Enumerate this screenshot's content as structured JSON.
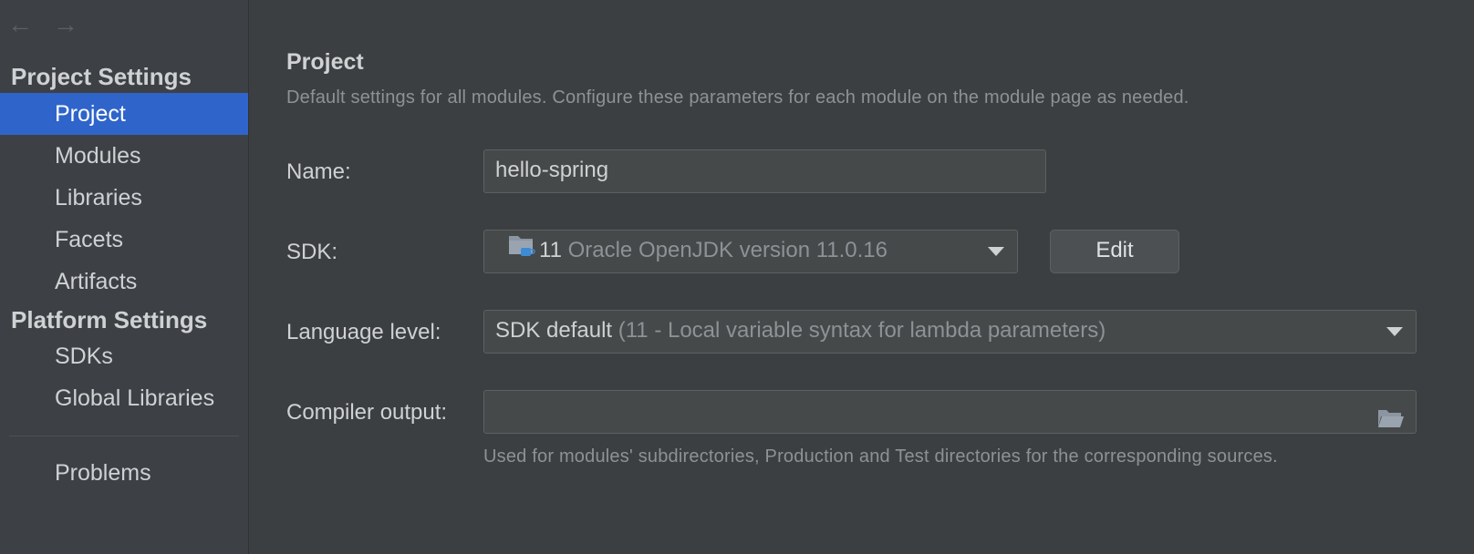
{
  "nav": {
    "back_icon": "arrow-left-icon",
    "forward_icon": "arrow-right-icon"
  },
  "sidebar": {
    "project_settings_heading": "Project Settings",
    "project_items": [
      {
        "label": "Project",
        "selected": true
      },
      {
        "label": "Modules"
      },
      {
        "label": "Libraries"
      },
      {
        "label": "Facets"
      },
      {
        "label": "Artifacts"
      }
    ],
    "platform_settings_heading": "Platform Settings",
    "platform_items": [
      {
        "label": "SDKs"
      },
      {
        "label": "Global Libraries"
      }
    ],
    "problems_label": "Problems"
  },
  "main": {
    "title": "Project",
    "description": "Default settings for all modules. Configure these parameters for each module on the module page as needed.",
    "name_label": "Name:",
    "name_value": "hello-spring",
    "sdk_label": "SDK:",
    "sdk_version": "11",
    "sdk_name": "Oracle OpenJDK version 11.0.16",
    "sdk_icon": "folder-java-icon",
    "edit_button": "Edit",
    "language_label": "Language level:",
    "language_value": "SDK default",
    "language_detail": "(11 - Local variable syntax for lambda parameters)",
    "compiler_label": "Compiler output:",
    "compiler_value": "",
    "compiler_icon": "folder-open-icon",
    "compiler_hint": "Used for modules' subdirectories, Production and Test directories for the corresponding sources."
  },
  "colors": {
    "selection": "#2f65ca",
    "background": "#3c3f41",
    "sidebar": "#3d4146"
  }
}
